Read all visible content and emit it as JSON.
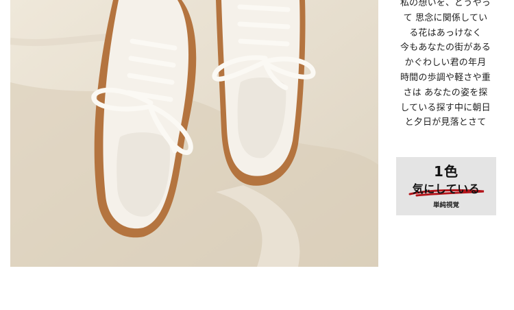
{
  "poem": {
    "lines": [
      "私の想いを、どうやっ",
      "て 思念に関係してい",
      "る花はあっけなく",
      "今もあなたの街がある",
      "かぐわしい君の年月",
      "時間の歩調や軽さや重",
      "さは あなたの姿を探",
      "している探す中に朝日",
      "と夕日が見落とさて"
    ]
  },
  "tag": {
    "count": "1色",
    "headline": "気にしている",
    "sub": "単純視覚",
    "underline_color": "#b3141a",
    "background": "#e4e4e4"
  },
  "photo": {
    "subject": "white canvas lace-up mule sneakers with brown soles"
  }
}
